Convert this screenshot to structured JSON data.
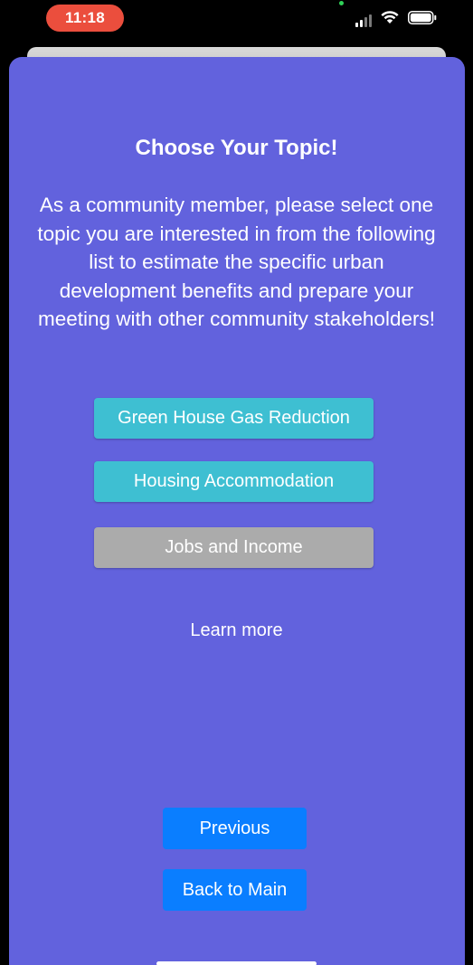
{
  "status_bar": {
    "time": "11:18"
  },
  "modal": {
    "title": "Choose Your Topic!",
    "description": "As a community member, please select one topic you are interested in from the following list to estimate the specific urban development benefits and prepare your meeting with other community stakeholders!",
    "topics": [
      {
        "label": "Green House Gas Reduction",
        "color": "#3ebfd2",
        "enabled": true
      },
      {
        "label": "Housing Accommodation",
        "color": "#3ebfd2",
        "enabled": true
      },
      {
        "label": "Jobs and Income",
        "color": "#ababab",
        "enabled": false
      }
    ],
    "learn_more": "Learn more",
    "previous_label": "Previous",
    "back_to_main_label": "Back to Main"
  },
  "colors": {
    "card_background": "#6262dd",
    "nav_button": "#0a7eff",
    "time_pill": "#eb4e3d"
  },
  "icons": [
    "signal-icon",
    "wifi-icon",
    "battery-icon"
  ]
}
